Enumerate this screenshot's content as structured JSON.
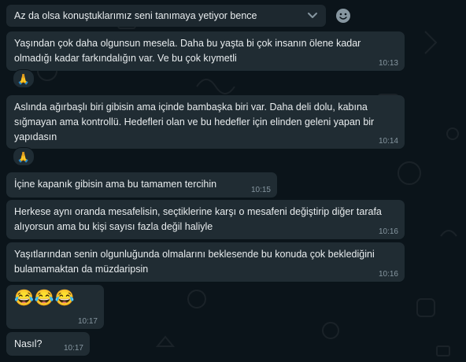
{
  "quoted": {
    "text": "Az da olsa konuştuklarımız seni tanımaya yetiyor bence"
  },
  "messages": [
    {
      "text": "Yaşından çok daha olgunsun mesela. Daha bu yaşta bi çok insanın ölene kadar olmadığı kadar farkındalığın var. Ve bu çok kıymetli",
      "time": "10:13",
      "reaction": "🙏"
    },
    {
      "text": "Aslında ağırbaşlı biri gibisin ama içinde bambaşka biri var. Daha deli dolu, kabına sığmayan ama kontrollü. Hedefleri olan ve bu hedefler için elinden geleni yapan bir yapıdasın",
      "time": "10:14",
      "reaction": "🙏"
    },
    {
      "text": "İçine kapanık gibisin ama bu tamamen tercihin",
      "time": "10:15"
    },
    {
      "text": "Herkese aynı oranda mesafelisin, seçtiklerine karşı o mesafeni değiştirip diğer tarafa alıyorsun ama bu kişi sayısı fazla değil haliyle",
      "time": "10:16"
    },
    {
      "text": "Yaşıtlarından senin olgunluğunda olmalarını beklesende bu konuda çok beklediğini bulamamaktan da müzdaripsin",
      "time": "10:16"
    },
    {
      "text": "😂😂😂",
      "time": "10:17"
    },
    {
      "text": "Nasıl?",
      "time": "10:17"
    }
  ],
  "icons": {
    "chevron": "chevron-down-icon",
    "emoji": "smiley-icon",
    "reaction": "folded-hands-icon"
  },
  "colors": {
    "background": "#0b141a",
    "incoming_bubble": "#202c33",
    "timestamp": "#8696a0",
    "text": "#e9edef"
  }
}
